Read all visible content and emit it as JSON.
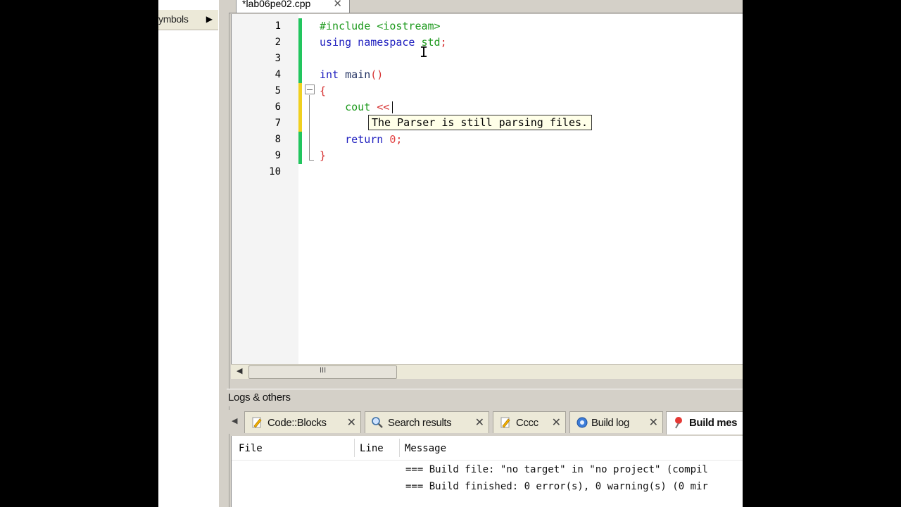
{
  "symbols_panel": {
    "tab_label": "ymbols",
    "arrow": "▶"
  },
  "editor": {
    "file_tab": {
      "name": "*lab06pe02.cpp",
      "close": "✕"
    },
    "line_numbers": [
      "1",
      "2",
      "3",
      "4",
      "5",
      "6",
      "7",
      "8",
      "9",
      "10"
    ],
    "code": {
      "l1": "#include <iostream>",
      "l2_kw": "using namespace",
      "l2_id": " std",
      "l2_semi": ";",
      "l4_kw": "int",
      "l4_fn": " main",
      "l4_parens": "()",
      "l5": "{",
      "l6_indent": "    ",
      "l6_id": "cout",
      "l6_op": " <<",
      "l8_indent": "    ",
      "l8_kw": "return",
      "l8_num": " 0",
      "l8_semi": ";",
      "l9": "}"
    },
    "tooltip": "The Parser is still parsing files.",
    "scroll_grip": "III"
  },
  "logs": {
    "title": "Logs & others",
    "tabs": [
      {
        "label": "Code::Blocks",
        "icon": "pencil-icon"
      },
      {
        "label": "Search results",
        "icon": "magnifier-icon"
      },
      {
        "label": "Cccc",
        "icon": "pencil-icon"
      },
      {
        "label": "Build log",
        "icon": "gear-icon"
      },
      {
        "label": "Build mes",
        "icon": "pin-icon"
      }
    ],
    "columns": {
      "file": "File",
      "line": "Line",
      "message": "Message"
    },
    "rows": [
      "=== Build file: \"no target\" in \"no project\" (compil",
      "=== Build finished: 0 error(s), 0 warning(s) (0 mir"
    ]
  },
  "colors": {
    "change_saved": "#22c55e",
    "change_unsaved": "#f0d020",
    "tooltip_bg": "#ffffe8"
  }
}
